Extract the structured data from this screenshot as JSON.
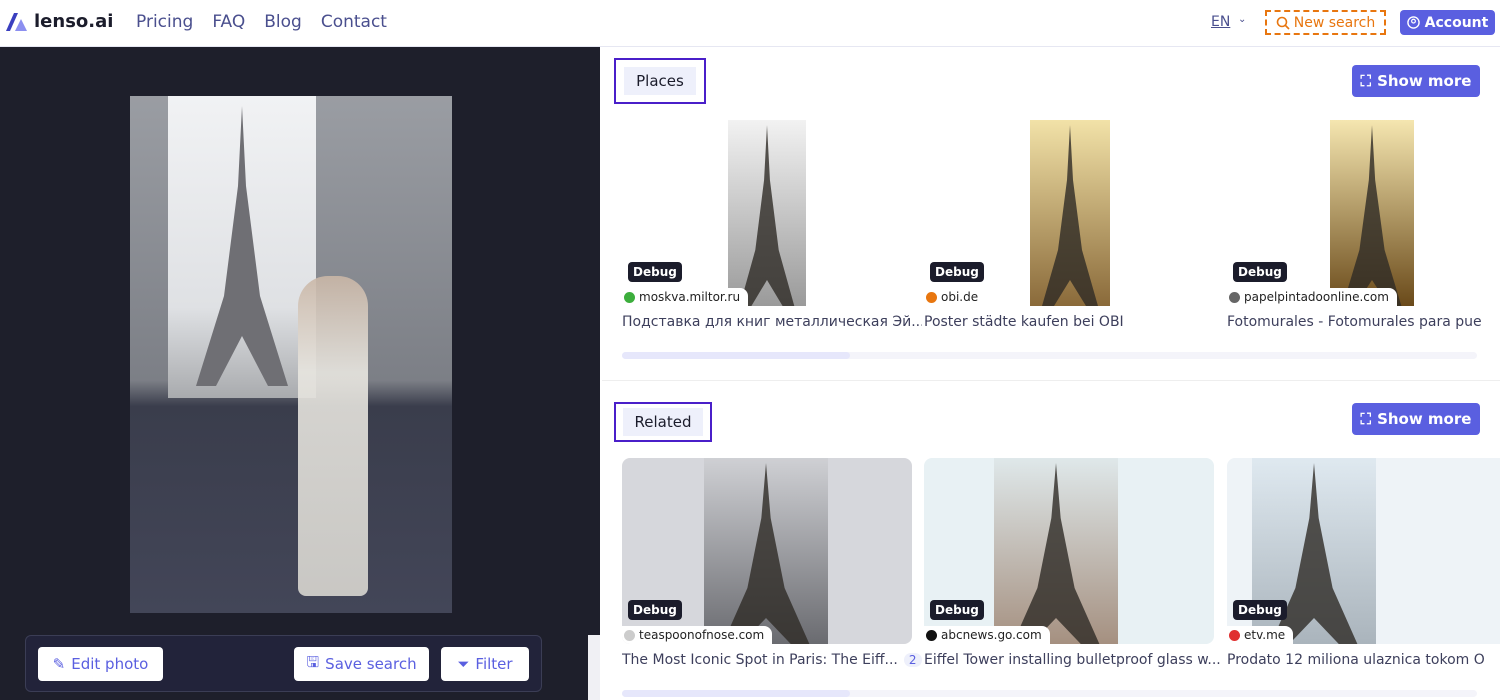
{
  "header": {
    "brand": "lenso.ai",
    "nav": [
      "Pricing",
      "FAQ",
      "Blog",
      "Contact"
    ],
    "language": "EN",
    "new_search": "New search",
    "account": "Account"
  },
  "colors": {
    "accent": "#5a5fe0",
    "highlight_border": "#4a1fc9",
    "new_search": "#e8760f"
  },
  "toolbar": {
    "edit": "Edit photo",
    "save": "Save search",
    "filter": "Filter"
  },
  "places": {
    "title": "Places",
    "show_more": "Show more",
    "items": [
      {
        "badge": "Debug",
        "source": "moskva.miltor.ru",
        "title": "Подставка для книг металлическая Эй...",
        "fav": "#3cae3c",
        "bg": "#fff",
        "strip": "linear-gradient(#f2f2f2,#9a9a9a)"
      },
      {
        "badge": "Debug",
        "source": "obi.de",
        "title": "Poster städte kaufen bei OBI",
        "fav": "#e8760f",
        "bg": "#fff",
        "strip": "linear-gradient(#f2e2a8,#8a6a3a)"
      },
      {
        "badge": "Debug",
        "source": "papelpintadoonline.com",
        "title": "Fotomurales - Fotomurales para pue",
        "fav": "#666",
        "bg": "#fff",
        "strip": "linear-gradient(#f5e6b0,#6a4a1a)"
      }
    ]
  },
  "related": {
    "title": "Related",
    "show_more": "Show more",
    "items": [
      {
        "badge": "Debug",
        "source": "teaspoonofnose.com",
        "title": "The Most Iconic Spot in Paris: The Eiff...",
        "count": "2",
        "fav": "#ccc",
        "bg": "#d6d7dc",
        "strip": "linear-gradient(#cfd0d4,#6a6b70)"
      },
      {
        "badge": "Debug",
        "source": "abcnews.go.com",
        "title": "Eiffel Tower installing bulletproof glass w...",
        "fav": "#111",
        "bg": "#e8f1f4",
        "strip": "linear-gradient(#dfe8ea,#a59080)"
      },
      {
        "badge": "Debug",
        "source": "etv.me",
        "title": "Prodato 12 miliona ulaznica tokom O",
        "fav": "#e03030",
        "bg": "#eef3f7",
        "strip": "linear-gradient(#dfe9f0,#aab4bc)"
      }
    ]
  }
}
